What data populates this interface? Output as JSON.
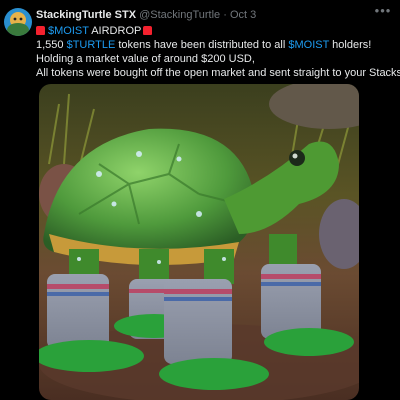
{
  "post": {
    "author_name": "StackingTurtle STX",
    "author_handle": "@StackingTurtle",
    "separator": "·",
    "date": "Oct 3",
    "more_icon": "more-horizontal-icon",
    "line1_cashtag": "$MOIST",
    "line1_text": " AIRDROP",
    "line2_prefix": "1,550 ",
    "line2_cashtag1": "$TURTLE",
    "line2_mid": "  tokens have been distributed to all ",
    "line2_cashtag2": "$MOIST",
    "line2_suffix": " holders!",
    "line3": "Holding a market value of around  $200 USD,",
    "line4": "All tokens were bought off the open market and sent straight to your Stacks"
  },
  "colors": {
    "background": "#000000",
    "text": "#e7e9ea",
    "secondary": "#71767b",
    "cashtag": "#1d9bf0",
    "siren": "#f4212e"
  }
}
